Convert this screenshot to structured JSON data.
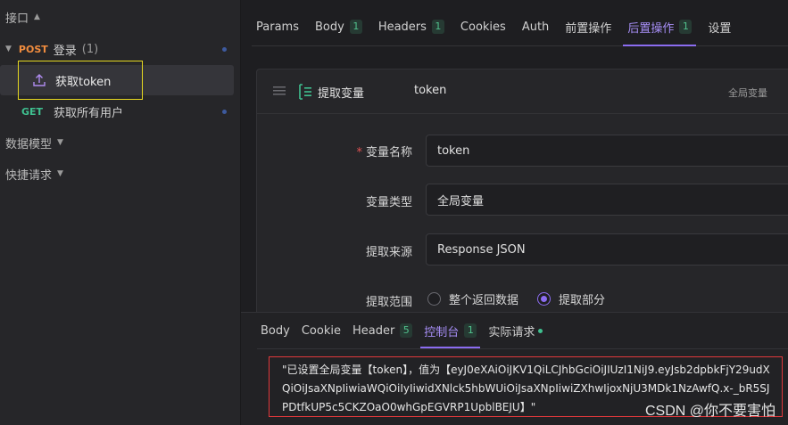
{
  "sidebar": {
    "section_interfaces": "接口",
    "folder": {
      "method": "POST",
      "name": "登录",
      "count": "(1)"
    },
    "items": [
      {
        "name": "获取token",
        "selected": true
      },
      {
        "method": "GET",
        "name": "获取所有用户"
      }
    ],
    "section_models": "数据模型",
    "section_quick": "快捷请求"
  },
  "tabs": [
    {
      "label": "Params"
    },
    {
      "label": "Body",
      "badge": "1"
    },
    {
      "label": "Headers",
      "badge": "1"
    },
    {
      "label": "Cookies"
    },
    {
      "label": "Auth"
    },
    {
      "label": "前置操作"
    },
    {
      "label": "后置操作",
      "badge": "1",
      "active": true
    },
    {
      "label": "设置"
    }
  ],
  "card": {
    "title": "提取变量",
    "variable": "token",
    "scope_label": "全局变量",
    "fields": {
      "name_label": "变量名称",
      "name_value": "token",
      "type_label": "变量类型",
      "type_value": "全局变量",
      "source_label": "提取来源",
      "source_value": "Response JSON",
      "range_label": "提取范围",
      "range_option_all": "整个返回数据",
      "range_option_part": "提取部分",
      "range_selected": "提取部分"
    }
  },
  "bottom_tabs": [
    {
      "label": "Body"
    },
    {
      "label": "Cookie"
    },
    {
      "label": "Header",
      "badge": "5"
    },
    {
      "label": "控制台",
      "badge": "1",
      "active": true
    },
    {
      "label": "实际请求"
    }
  ],
  "console_text": "\"已设置全局变量【token】，值为【eyJ0eXAiOiJKV1QiLCJhbGciOiJIUzI1NiJ9.eyJsb2dpbkFjY29udXQiOiJsaXNpIiwiaWQiOiIyIiwidXNlck5hbWUiOiJsaXNpIiwiZXhwIjoxNjU3MDk1NzAwfQ.x-_bR5SJPDtfkUP5c5CKZOaO0whGpEGVRP1UpblBEJU】\"",
  "watermark": "CSDN @你不要害怕",
  "colors": {
    "accent": "#8b6cf0",
    "post": "#f08c3e",
    "get": "#3fbf8f",
    "highlight": "#e6d820",
    "console_border": "#e0383b"
  }
}
